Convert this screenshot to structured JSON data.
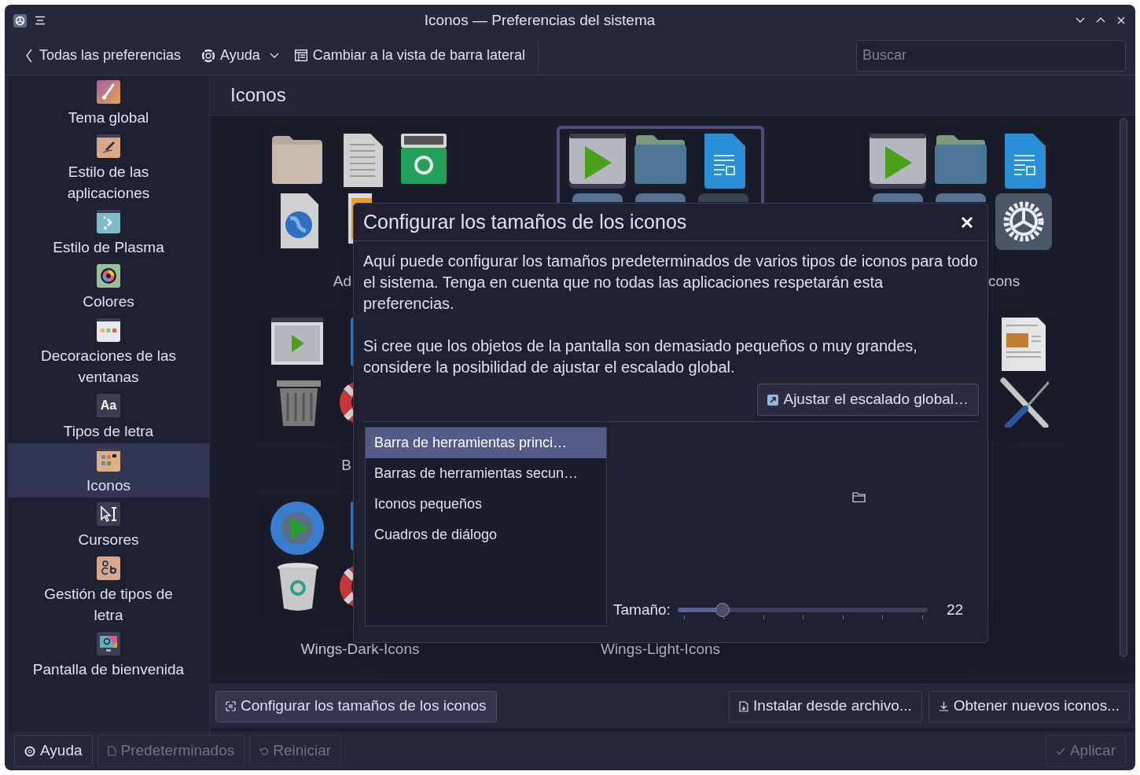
{
  "window": {
    "title": "Iconos — Preferencias del sistema"
  },
  "toolbar": {
    "back": "Todas las preferencias",
    "help": "Ayuda",
    "switch_view": "Cambiar a la vista de barra lateral",
    "search": {
      "placeholder": "Buscar"
    }
  },
  "sidebar": {
    "items": [
      {
        "label": "Tema global",
        "selected": false
      },
      {
        "label": "Estilo de las aplicaciones",
        "selected": false
      },
      {
        "label": "Estilo de Plasma",
        "selected": false
      },
      {
        "label": "Colores",
        "selected": false
      },
      {
        "label": "Decoraciones de las ventanas",
        "selected": false
      },
      {
        "label": "Tipos de letra",
        "selected": false,
        "icon_text": "Aa"
      },
      {
        "label": "Iconos",
        "selected": true
      },
      {
        "label": "Cursores",
        "selected": false
      },
      {
        "label": "Gestión de tipos de letra",
        "selected": false
      },
      {
        "label": "Pantalla de bienvenida",
        "selected": false
      }
    ]
  },
  "page": {
    "title": "Iconos",
    "themes": [
      {
        "label": "Ad",
        "selected": false
      },
      {
        "selected": true
      },
      {
        "label": "cons",
        "selected": false
      },
      {
        "label": "B",
        "selected": false
      },
      {
        "selected": false
      },
      {
        "label": "Wings-Dark-Icons",
        "selected": false
      },
      {
        "label": "Wings-Light-Icons"
      }
    ],
    "configure_button": "Configurar los tamaños de los iconos",
    "install_button": "Instalar desde archivo...",
    "get_new_button": "Obtener nuevos iconos..."
  },
  "dialog": {
    "title": "Configurar los tamaños de los iconos",
    "paragraphs": [
      "Aquí puede configurar los tamaños predeterminados de varios tipos de iconos para todo el sistema. Tenga en cuenta que no todas las aplicaciones respetarán esta preferencias.",
      "Si cree que los objetos de la pantalla son demasiado pequeños o muy grandes, considere la posibilidad de ajustar el escalado global."
    ],
    "scale_button": "Ajustar el escalado global…",
    "groups": [
      {
        "label": "Barra de herramientas princi…",
        "selected": true
      },
      {
        "label": "Barras de herramientas secun…",
        "selected": false
      },
      {
        "label": "Iconos pequeños",
        "selected": false
      },
      {
        "label": "Cuadros de diálogo",
        "selected": false
      }
    ],
    "size_label": "Tamaño:",
    "size": {
      "level": 0.18
    },
    "size_value": "22"
  },
  "footer": {
    "help": "Ayuda",
    "defaults": {
      "label": "Predeterminados",
      "disabled": true
    },
    "reset": {
      "label": "Reiniciar",
      "disabled": true
    },
    "apply": {
      "label": "Aplicar",
      "disabled": true
    }
  }
}
